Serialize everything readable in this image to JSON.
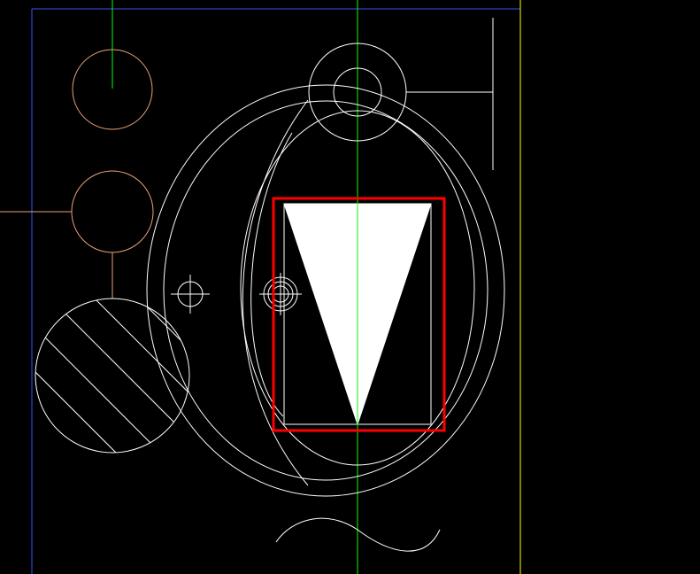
{
  "canvas": {
    "background": "#000000"
  },
  "colors": {
    "geometry": "#ffffff",
    "hatch": "#ffffff",
    "fill": "#ffffff",
    "circles_top_left": "#e8a27a",
    "axis_vertical": "#00ff00",
    "border_left_top": "#3355ff",
    "border_right": "#ffff00",
    "selection": "#ff0000"
  },
  "icons": {
    "crosshair": "crosshair-marker-icon",
    "selection": "selection-box-icon"
  },
  "selection": {
    "active": true,
    "target": "inverted-triangle-block"
  }
}
